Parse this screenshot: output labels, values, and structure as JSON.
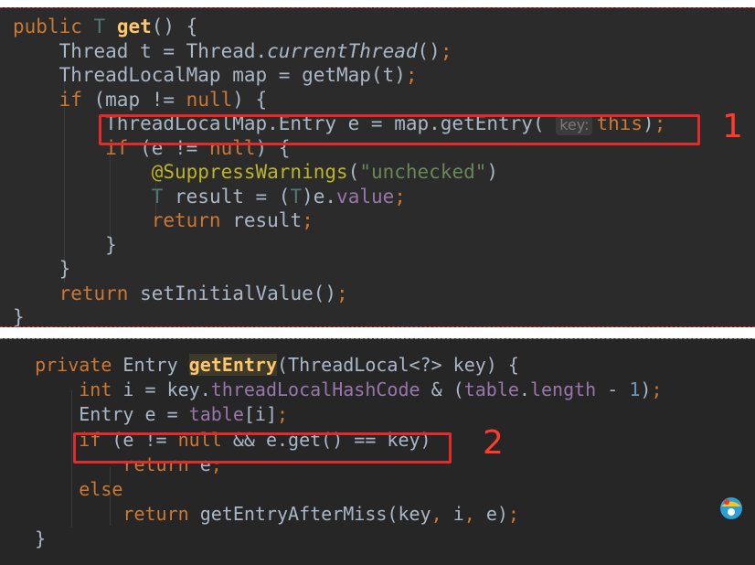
{
  "snippet1": {
    "lines": [
      [
        {
          "t": "public ",
          "c": "kw"
        },
        {
          "t": "T ",
          "c": "tp"
        },
        {
          "t": "get",
          "c": "fn"
        },
        {
          "t": "() {"
        }
      ],
      [
        {
          "t": "    Thread t = Thread."
        },
        {
          "t": "currentThread",
          "c": "ital"
        },
        {
          "t": "()"
        },
        {
          "t": ";",
          "c": "kw"
        }
      ],
      [
        {
          "t": "    ThreadLocalMap map = getMap(t)"
        },
        {
          "t": ";",
          "c": "kw"
        }
      ],
      [
        {
          "t": "    "
        },
        {
          "t": "if ",
          "c": "kw"
        },
        {
          "t": "(map != "
        },
        {
          "t": "null",
          "c": "kw"
        },
        {
          "t": ") {"
        }
      ],
      [
        {
          "t": "        ThreadLocalMap.Entry e = map.getEntry( "
        },
        {
          "t": "key:",
          "c": "hint"
        },
        {
          "t": "this",
          "c": "kw"
        },
        {
          "t": ")"
        },
        {
          "t": ";",
          "c": "kw"
        }
      ],
      [
        {
          "t": "        "
        },
        {
          "t": "if ",
          "c": "kw"
        },
        {
          "t": "(e != "
        },
        {
          "t": "null",
          "c": "kw"
        },
        {
          "t": ") {"
        }
      ],
      [
        {
          "t": "            "
        },
        {
          "t": "@SuppressWarnings",
          "c": "anno"
        },
        {
          "t": "("
        },
        {
          "t": "\"unchecked\"",
          "c": "str"
        },
        {
          "t": ")"
        }
      ],
      [
        {
          "t": "            "
        },
        {
          "t": "T ",
          "c": "tp"
        },
        {
          "t": "result = ("
        },
        {
          "t": "T",
          "c": "tp"
        },
        {
          "t": ")e."
        },
        {
          "t": "value",
          "c": "fld"
        },
        {
          "t": ";",
          "c": "kw"
        }
      ],
      [
        {
          "t": "            "
        },
        {
          "t": "return ",
          "c": "kw"
        },
        {
          "t": "result"
        },
        {
          "t": ";",
          "c": "kw"
        }
      ],
      [
        {
          "t": "        }"
        }
      ],
      [
        {
          "t": "    }"
        }
      ],
      [
        {
          "t": "    "
        },
        {
          "t": "return ",
          "c": "kw"
        },
        {
          "t": "setInitialValue()"
        },
        {
          "t": ";",
          "c": "kw"
        }
      ],
      [
        {
          "t": "}"
        }
      ]
    ],
    "marker": "1"
  },
  "snippet2": {
    "lines": [
      [
        {
          "t": "  "
        },
        {
          "t": "private ",
          "c": "kw"
        },
        {
          "t": "Entry "
        },
        {
          "t": "getEntry",
          "c": "fn hl-get"
        },
        {
          "t": "(ThreadLocal<?> key) {"
        }
      ],
      [
        {
          "t": "      "
        },
        {
          "t": "int ",
          "c": "kw"
        },
        {
          "t": "i = key."
        },
        {
          "t": "threadLocalHashCode",
          "c": "fld"
        },
        {
          "t": " & ("
        },
        {
          "t": "table",
          "c": "fld"
        },
        {
          "t": "."
        },
        {
          "t": "length",
          "c": "fld"
        },
        {
          "t": " - "
        },
        {
          "t": "1",
          "c": "num"
        },
        {
          "t": ")"
        },
        {
          "t": ";",
          "c": "kw"
        }
      ],
      [
        {
          "t": "      Entry e = "
        },
        {
          "t": "table",
          "c": "fld"
        },
        {
          "t": "[i]"
        },
        {
          "t": ";",
          "c": "kw"
        }
      ],
      [
        {
          "t": "      "
        },
        {
          "t": "if ",
          "c": "kw"
        },
        {
          "t": "(e != "
        },
        {
          "t": "null ",
          "c": "kw"
        },
        {
          "t": "&& e.get() == key)"
        }
      ],
      [
        {
          "t": "          "
        },
        {
          "t": "return ",
          "c": "kw"
        },
        {
          "t": "e"
        },
        {
          "t": ";",
          "c": "kw"
        }
      ],
      [
        {
          "t": "      "
        },
        {
          "t": "else",
          "c": "kw"
        }
      ],
      [
        {
          "t": "          "
        },
        {
          "t": "return ",
          "c": "kw"
        },
        {
          "t": "getEntryAfterMiss(key"
        },
        {
          "t": ", ",
          "c": "kw"
        },
        {
          "t": "i"
        },
        {
          "t": ", ",
          "c": "kw"
        },
        {
          "t": "e)"
        },
        {
          "t": ";",
          "c": "kw"
        }
      ],
      [
        {
          "t": "  }"
        }
      ]
    ],
    "marker": "2"
  }
}
